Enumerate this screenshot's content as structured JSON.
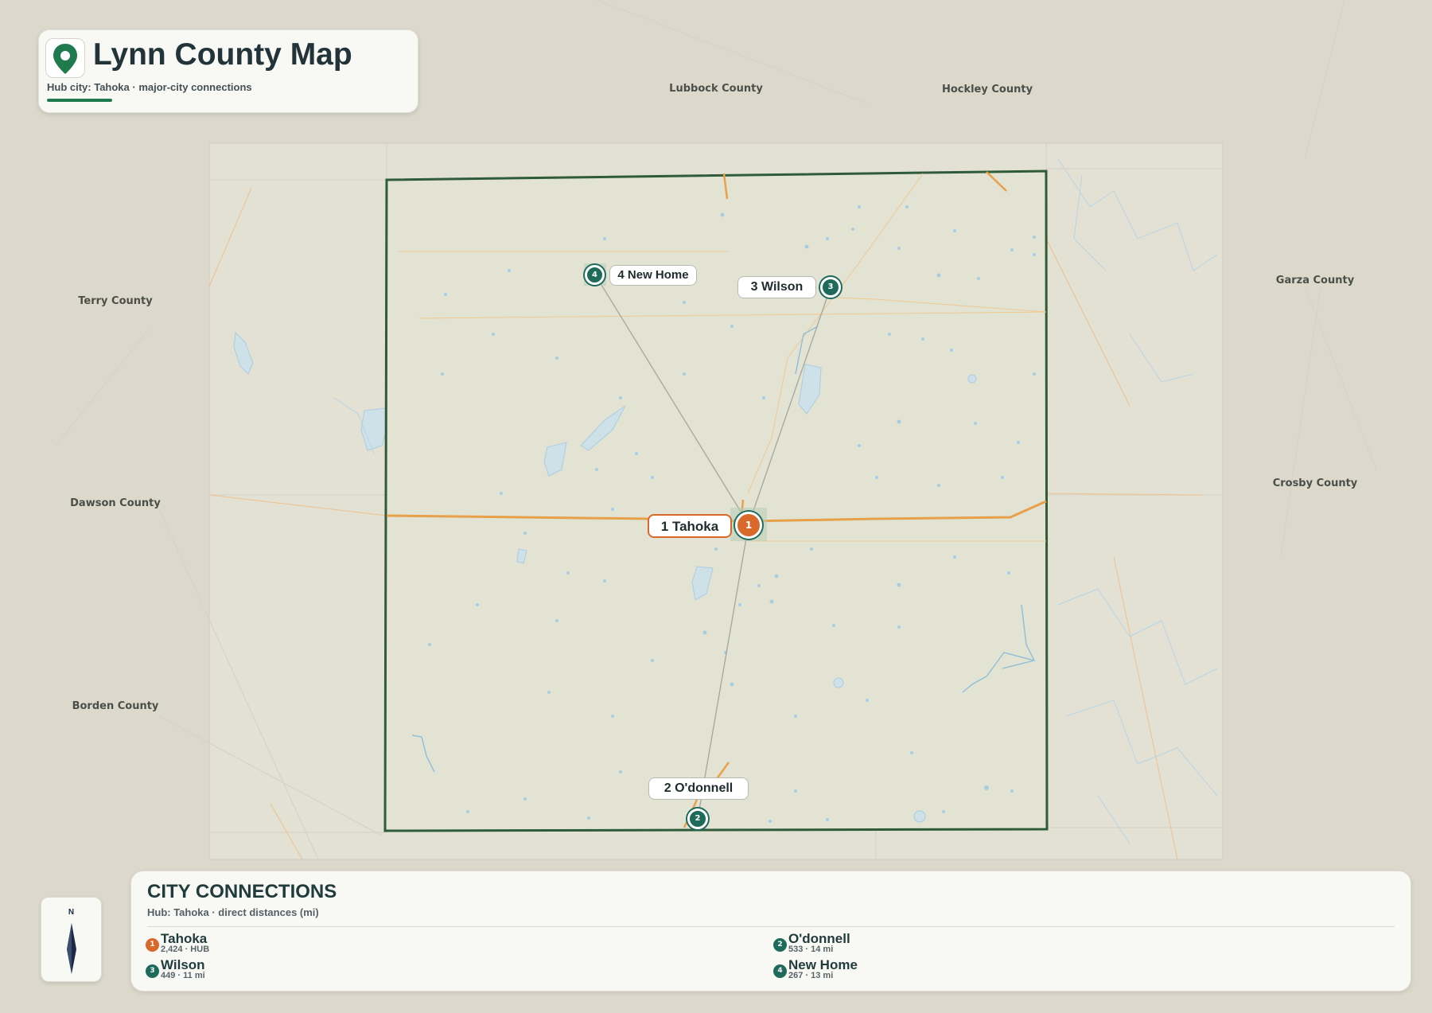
{
  "header": {
    "title": "Lynn County Map",
    "subtitle": "Hub city: Tahoka · major-city connections",
    "accent_color": "#1f7a4d",
    "icon": "map-pin-icon"
  },
  "neighbors": [
    "Lubbock County",
    "Hockley County",
    "Terry County",
    "Garza County",
    "Crosby County",
    "Dawson County",
    "Borden County"
  ],
  "cities": [
    {
      "num": "1",
      "name": "Tahoka",
      "label": "1 Tahoka",
      "hub": true,
      "color": "#d9692a"
    },
    {
      "num": "2",
      "name": "O'donnell",
      "label": "2 O'donnell",
      "hub": false,
      "color": "#1e6b5c"
    },
    {
      "num": "3",
      "name": "Wilson",
      "label": "3 Wilson",
      "hub": false,
      "color": "#1e6b5c"
    },
    {
      "num": "4",
      "name": "New Home",
      "label": "4 New Home",
      "hub": false,
      "color": "#1e6b5c"
    }
  ],
  "compass": {
    "north": "N",
    "icon": "compass-needle-icon"
  },
  "legend": {
    "title": "CITY CONNECTIONS",
    "subtitle": "Hub: Tahoka · direct distances (mi)",
    "entries": [
      {
        "num": "1",
        "name": "Tahoka",
        "meta": "2,424 · HUB",
        "color": "#d9692a"
      },
      {
        "num": "2",
        "name": "O'donnell",
        "meta": "533 · 14 mi",
        "color": "#1e6b5c"
      },
      {
        "num": "3",
        "name": "Wilson",
        "meta": "449 · 11 mi",
        "color": "#1e6b5c"
      },
      {
        "num": "4",
        "name": "New Home",
        "meta": "267 · 13 mi",
        "color": "#1e6b5c"
      }
    ]
  },
  "colors": {
    "county_border": "#2f5b38",
    "roads": "#e8a04a",
    "water": "#a9cde0",
    "connection_lines": "#a8aaa2"
  }
}
